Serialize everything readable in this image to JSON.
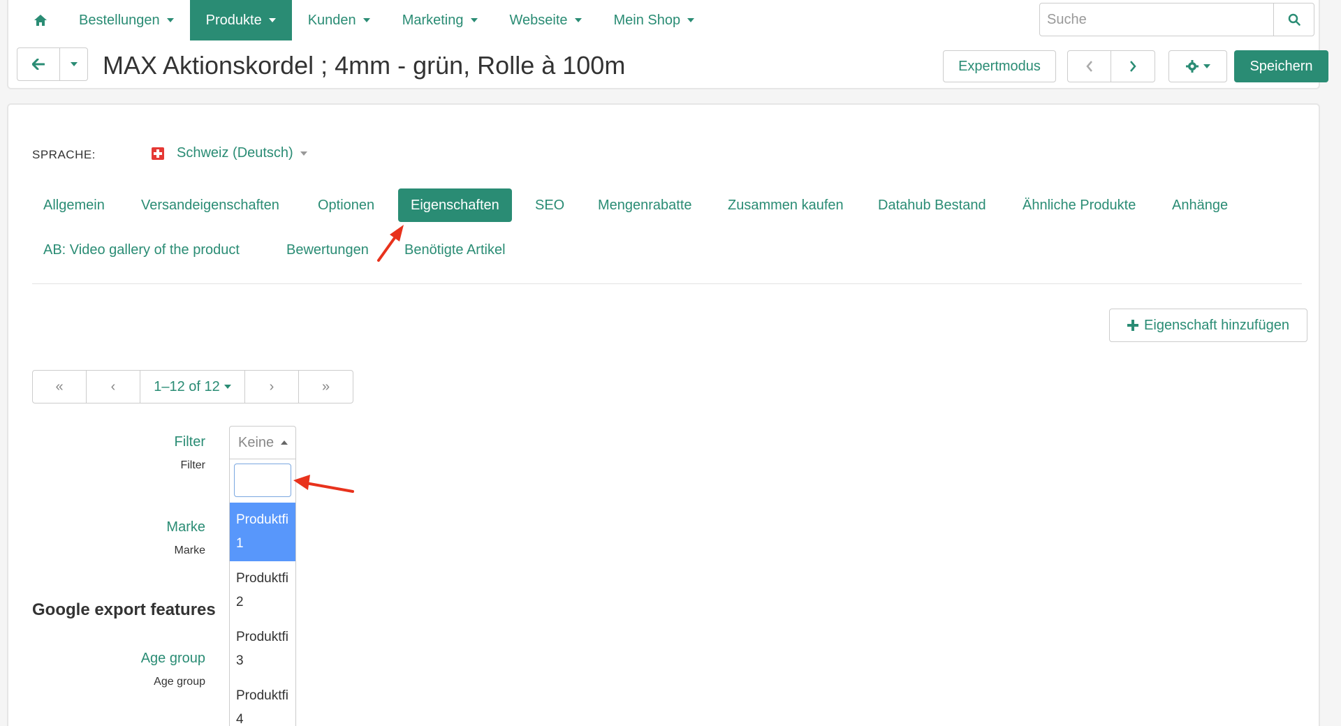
{
  "nav": {
    "items": [
      {
        "label": "Bestellungen",
        "active": false
      },
      {
        "label": "Produkte",
        "active": true
      },
      {
        "label": "Kunden",
        "active": false
      },
      {
        "label": "Marketing",
        "active": false
      },
      {
        "label": "Webseite",
        "active": false
      },
      {
        "label": "Mein Shop",
        "active": false
      }
    ],
    "search_placeholder": "Suche"
  },
  "header": {
    "title": "MAX Aktionskordel ; 4mm - grün, Rolle à 100m",
    "expert_label": "Expertmodus",
    "save_label": "Speichern"
  },
  "language": {
    "label": "SPRACHE:",
    "value": "Schweiz (Deutsch)"
  },
  "tabs": [
    {
      "label": "Allgemein",
      "active": false
    },
    {
      "label": "Versandeigenschaften",
      "active": false
    },
    {
      "label": "Optionen",
      "active": false
    },
    {
      "label": "Eigenschaften",
      "active": true
    },
    {
      "label": "SEO",
      "active": false
    },
    {
      "label": "Mengenrabatte",
      "active": false
    },
    {
      "label": "Zusammen kaufen",
      "active": false
    },
    {
      "label": "Datahub Bestand",
      "active": false
    },
    {
      "label": "Ähnliche Produkte",
      "active": false
    },
    {
      "label": "Anhänge",
      "active": false
    },
    {
      "label": "AB: Video gallery of the product",
      "active": false
    },
    {
      "label": "Bewertungen",
      "active": false
    },
    {
      "label": "Benötigte Artikel",
      "active": false
    }
  ],
  "add_property_label": "Eigenschaft hinzufügen",
  "pager": {
    "first": "«",
    "prev": "‹",
    "range": "1–12 of 12",
    "next": "›",
    "last": "»"
  },
  "fields": {
    "filter_label": "Filter",
    "filter_sub": "Filter",
    "filter_value": "Keine",
    "brand_label": "Marke",
    "brand_sub": "Marke",
    "section_title": "Google export features",
    "age_label": "Age group",
    "age_sub": "Age group"
  },
  "dropdown": {
    "search_value": "",
    "options": [
      {
        "line1": "Produktfi",
        "line2": "1",
        "selected": true
      },
      {
        "line1": "Produktfi",
        "line2": "2",
        "selected": false
      },
      {
        "line1": "Produktfi",
        "line2": "3",
        "selected": false
      },
      {
        "line1": "Produktfi",
        "line2": "4",
        "selected": false
      }
    ]
  },
  "colors": {
    "accent": "#2a8c74",
    "selected_option": "#5897fb",
    "annotation_arrow": "#e8321c"
  },
  "icons": [
    "home-icon",
    "search-icon",
    "arrow-left-icon",
    "chevron-left-icon",
    "chevron-right-icon",
    "gear-icon",
    "plus-icon",
    "flag-ch-icon"
  ]
}
